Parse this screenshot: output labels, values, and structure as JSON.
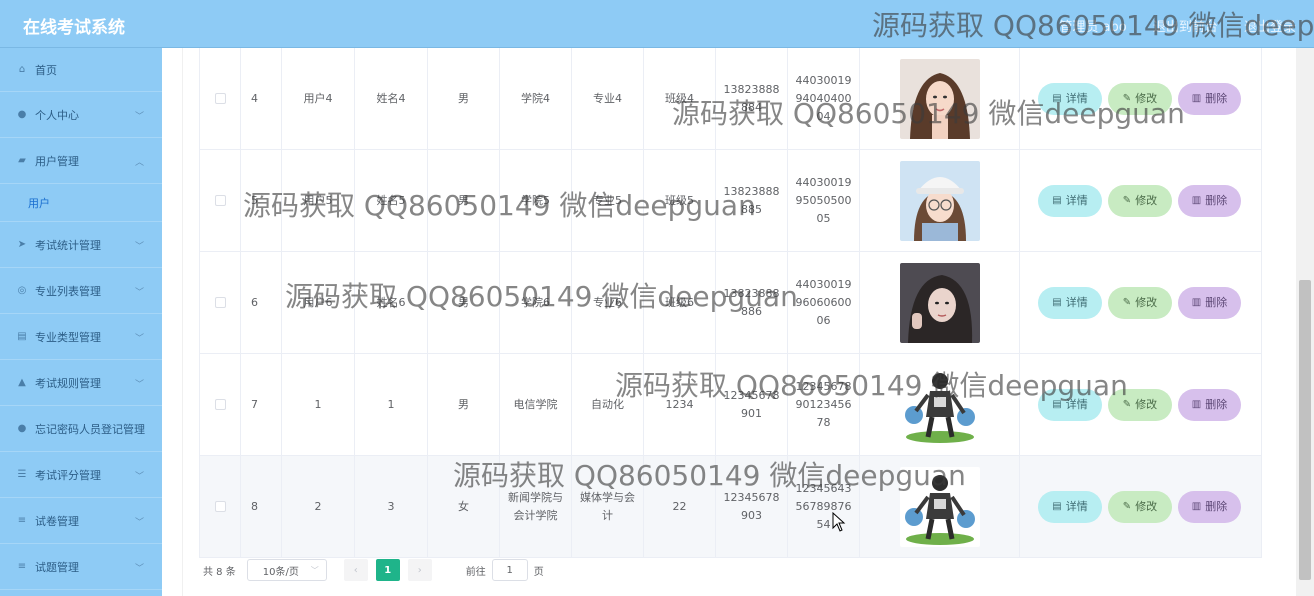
{
  "app": {
    "title": "在线考试系统",
    "top_links": [
      "管理员 abo",
      "退出到前台",
      "退出登录"
    ]
  },
  "sidebar": {
    "items": [
      {
        "label": "首页",
        "icon": "home-icon",
        "expandable": false
      },
      {
        "label": "个人中心",
        "icon": "person-icon",
        "expandable": true
      },
      {
        "label": "用户管理",
        "icon": "users-icon",
        "expandable": true,
        "open": true
      },
      {
        "label": "考试统计管理",
        "icon": "paper-plane-icon",
        "expandable": true
      },
      {
        "label": "专业列表管理",
        "icon": "compass-icon",
        "expandable": true
      },
      {
        "label": "专业类型管理",
        "icon": "clipboard-icon",
        "expandable": true
      },
      {
        "label": "考试规则管理",
        "icon": "thumbs-up-icon",
        "expandable": true
      },
      {
        "label": "忘记密码人员登记管理",
        "icon": "person-icon",
        "expandable": false
      },
      {
        "label": "考试评分管理",
        "icon": "sliders-icon",
        "expandable": true
      },
      {
        "label": "试卷管理",
        "icon": "list-icon",
        "expandable": true
      },
      {
        "label": "试题管理",
        "icon": "list-icon",
        "expandable": true
      }
    ],
    "submenu": {
      "label": "用户"
    }
  },
  "table": {
    "rows": [
      {
        "index": "4",
        "username": "用户4",
        "name": "姓名4",
        "sex": "男",
        "college": "学院4",
        "major": "专业4",
        "class": "班级4",
        "phone": "13823888884",
        "id_card": "440300199404040004",
        "photo": "woman-hair-down"
      },
      {
        "index": "5",
        "username": "用户5",
        "name": "姓名5",
        "sex": "男",
        "college": "学院5",
        "major": "专业5",
        "class": "班级5",
        "phone": "13823888885",
        "id_card": "440300199505050005",
        "photo": "woman-cap-glasses"
      },
      {
        "index": "6",
        "username": "用户6",
        "name": "姓名6",
        "sex": "男",
        "college": "学院6",
        "major": "专业6",
        "class": "班级6",
        "phone": "13823888886",
        "id_card": "440300199606060006",
        "photo": "woman-peace-sign"
      },
      {
        "index": "7",
        "username": "1",
        "name": "1",
        "sex": "男",
        "college": "电信学院",
        "major": "自动化",
        "class": "1234",
        "phone": "12345678901",
        "id_card": "123456789012345678",
        "photo": "anime-character"
      },
      {
        "index": "8",
        "username": "2",
        "name": "3",
        "sex": "女",
        "college": "新闻学院与会计学院",
        "major": "媒体学与会计",
        "class": "22",
        "phone": "12345678903",
        "id_card": "123456435678987654",
        "photo": "anime-character"
      }
    ],
    "actions": {
      "detail": "详情",
      "edit": "修改",
      "delete": "删除"
    }
  },
  "pagination": {
    "total": "共 8 条",
    "page_size": "10条/页",
    "current_page": "1",
    "goto_label": "前往",
    "goto_value": "1",
    "page_suffix": "页"
  },
  "watermark": {
    "text": "源码获取 QQ86050149 微信deepguan"
  }
}
